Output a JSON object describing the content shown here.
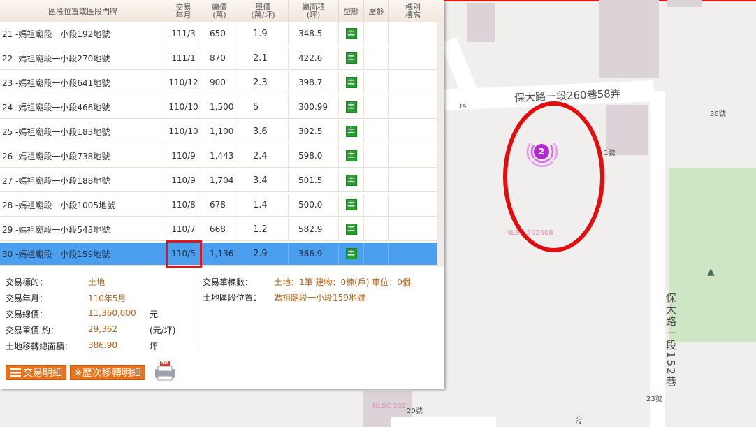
{
  "map": {
    "roads": {
      "upper": "保大路一段260巷58弄",
      "right": "保大路一段152巷"
    },
    "house_numbers": [
      "36號",
      "1號",
      "23號",
      "20號",
      "19",
      "20"
    ],
    "watermarks": [
      "NLSC 202408",
      "NLSC 202"
    ],
    "cluster_count": "2",
    "tree_icon": "▲"
  },
  "table": {
    "headers": {
      "location": "區段位置或區段門牌",
      "date": "交易\n年月",
      "total": "總價\n(萬)",
      "unit": "單價\n(萬/坪)",
      "area": "總面積\n(坪)",
      "type": "型態",
      "age": "屋齡",
      "floor": "樓別\n樓高"
    },
    "rows": [
      {
        "loc": "21 -媽祖廟段一小段192地號",
        "date": "111/3",
        "total": "650",
        "unit": "1.9",
        "area": "348.5",
        "type": "土"
      },
      {
        "loc": "22 -媽祖廟段一小段270地號",
        "date": "111/1",
        "total": "870",
        "unit": "2.1",
        "area": "422.6",
        "type": "土"
      },
      {
        "loc": "23 -媽祖廟段一小段641地號",
        "date": "110/12",
        "total": "900",
        "unit": "2.3",
        "area": "398.7",
        "type": "土"
      },
      {
        "loc": "24 -媽祖廟段一小段466地號",
        "date": "110/10",
        "total": "1,500",
        "unit": "5",
        "area": "300.99",
        "type": "土"
      },
      {
        "loc": "25 -媽祖廟段一小段183地號",
        "date": "110/10",
        "total": "1,100",
        "unit": "3.6",
        "area": "302.5",
        "type": "土"
      },
      {
        "loc": "26 -媽祖廟段一小段738地號",
        "date": "110/9",
        "total": "1,443",
        "unit": "2.4",
        "area": "598.0",
        "type": "土"
      },
      {
        "loc": "27 -媽祖廟段一小段188地號",
        "date": "110/9",
        "total": "1,704",
        "unit": "3.4",
        "area": "501.5",
        "type": "土"
      },
      {
        "loc": "28 -媽祖廟段一小段1005地號",
        "date": "110/8",
        "total": "678",
        "unit": "1.4",
        "area": "500.0",
        "type": "土"
      },
      {
        "loc": "29 -媽祖廟段一小段543地號",
        "date": "110/7",
        "total": "668",
        "unit": "1.2",
        "area": "582.9",
        "type": "土"
      },
      {
        "loc": "30 -媽祖廟段一小段159地號",
        "date": "110/5",
        "total": "1,136",
        "unit": "2.9",
        "area": "386.9",
        "type": "土"
      }
    ]
  },
  "detail": {
    "target_label": "交易標的：",
    "target_value": "土地",
    "month_label": "交易年月：",
    "month_value": "110年5月",
    "price_label": "交易總價：",
    "price_value": "11,360,000",
    "price_unit": "元",
    "unitprice_label": "交易單價 約：",
    "unitprice_value": "29,362",
    "unitprice_unit": "(元/坪)",
    "area_label": "土地移轉總面積：",
    "area_value": "386.90",
    "area_unit": "坪",
    "count_label": "交易筆棟數：",
    "count_value": "土地：1筆 建物：0棟(戶) 車位：0個",
    "location_label": "土地區段位置：",
    "location_value": "媽祖廟段一小段159地號"
  },
  "buttons": {
    "detail": "交易明細",
    "history": "※歷次移轉明細",
    "pdf_badge": "PDF"
  },
  "colors": {
    "selected_row": "#4aa0ee",
    "highlight": "#e0161b",
    "button": "#e8731d",
    "value_text": "#b3651a"
  }
}
